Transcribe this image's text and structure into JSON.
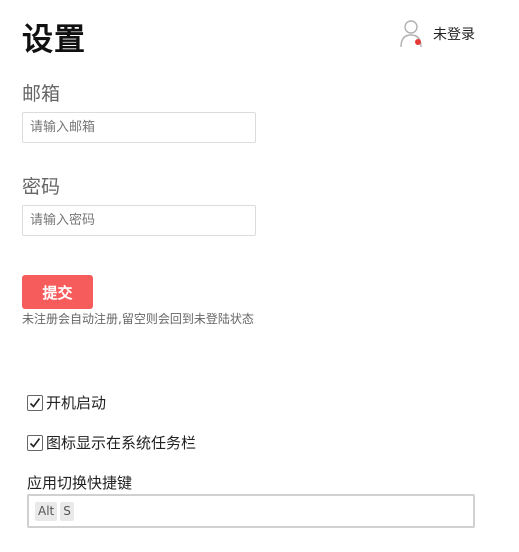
{
  "header": {
    "title": "设置",
    "user_status": "未登录",
    "avatar_icon": "user-outline-icon",
    "status_dot_color": "#e53935"
  },
  "form": {
    "email_label": "邮箱",
    "email_placeholder": "请输入邮箱",
    "email_value": "",
    "password_label": "密码",
    "password_placeholder": "请输入密码",
    "password_value": "",
    "submit_label": "提交",
    "submit_color": "#f75c5c",
    "hint": "未注册会自动注册,留空则会回到未登陆状态"
  },
  "options": {
    "autostart_label": "开机启动",
    "autostart_checked": true,
    "tray_icon_label": "图标显示在系统任务栏",
    "tray_icon_checked": true
  },
  "hotkey": {
    "label": "应用切换快捷键",
    "keys": [
      "Alt",
      "S"
    ]
  }
}
